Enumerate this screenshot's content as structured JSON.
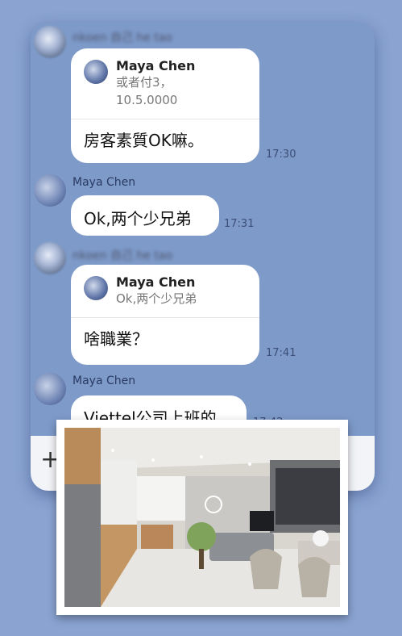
{
  "chat": {
    "messages": [
      {
        "sender_blurred": "nkoen 自己 he tao",
        "quote": {
          "name": "Maya Chen",
          "text": "或者付3，\n10.5.0000"
        },
        "text": "房客素質OK嘛。",
        "time": "17:30"
      },
      {
        "sender": "Maya Chen",
        "text": "Ok,两个少兄弟",
        "time": "17:31"
      },
      {
        "sender_blurred": "nkoen 自己 he tao",
        "quote": {
          "name": "Maya Chen",
          "text": "Ok,两个少兄弟"
        },
        "text": "啥職業？",
        "time": "17:41"
      },
      {
        "sender": "Maya Chen",
        "text": "Viettel公司上班的",
        "time": "17:42"
      }
    ]
  },
  "input_bar": {
    "plus_label": "+"
  },
  "photo": {
    "description_icon": "apartment-photo"
  }
}
